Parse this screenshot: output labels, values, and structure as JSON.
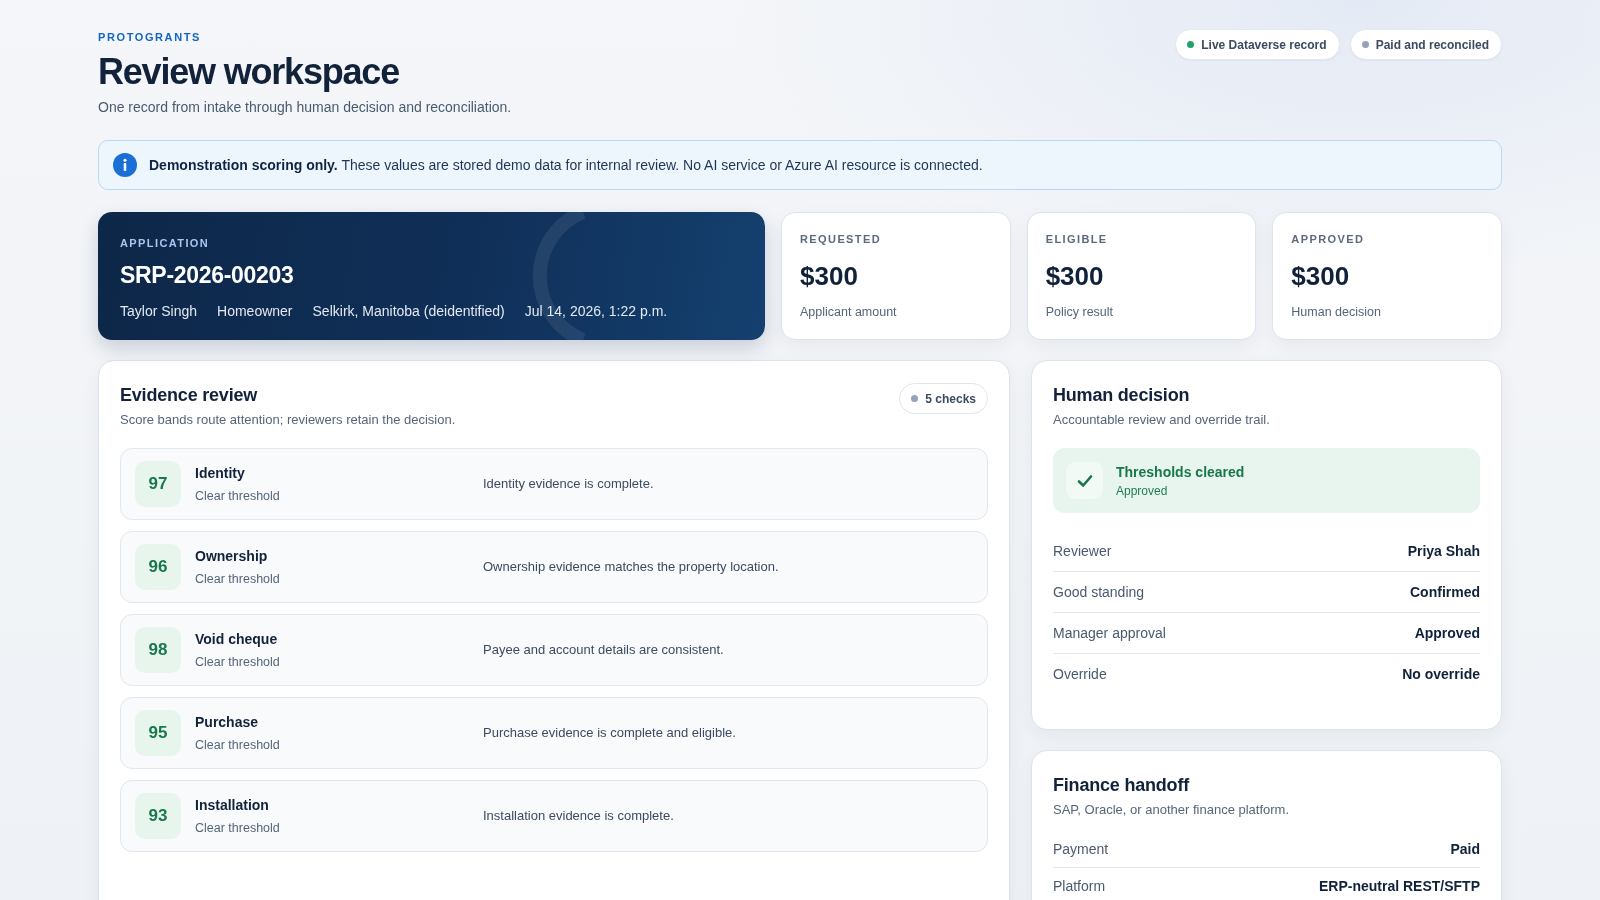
{
  "header": {
    "eyebrow": "PROTOGRANTS",
    "title": "Review workspace",
    "subtitle": "One record from intake through human decision and reconciliation."
  },
  "status_pills": [
    {
      "label": "Live Dataverse record",
      "color": "#22a06b"
    },
    {
      "label": "Paid and reconciled",
      "color": "#94a3b8"
    }
  ],
  "notice": {
    "text": "**Demonstration scoring only.** These values are stored demo data for internal review. No AI service or Azure AI resource is connected."
  },
  "application": {
    "label": "APPLICATION",
    "id": "SRP-2026-00203",
    "meta": [
      "Taylor Singh",
      "Homeowner",
      "Selkirk, Manitoba (deidentified)",
      "Jul 14, 2026, 1:22 p.m."
    ]
  },
  "amounts": [
    {
      "label": "REQUESTED",
      "value": "$300",
      "note": "Applicant amount"
    },
    {
      "label": "ELIGIBLE",
      "value": "$300",
      "note": "Policy result"
    },
    {
      "label": "APPROVED",
      "value": "$300",
      "note": "Human decision"
    }
  ],
  "evidence_review": {
    "title": "Evidence review",
    "subtitle": "Score bands route attention; reviewers retain the decision.",
    "count": "5 checks",
    "checks": [
      {
        "score": "97",
        "name": "Identity",
        "band": "Clear threshold",
        "finding": "Identity evidence is complete."
      },
      {
        "score": "96",
        "name": "Ownership",
        "band": "Clear threshold",
        "finding": "Ownership evidence matches the property location."
      },
      {
        "score": "98",
        "name": "Void cheque",
        "band": "Clear threshold",
        "finding": "Payee and account details are consistent."
      },
      {
        "score": "95",
        "name": "Purchase",
        "band": "Clear threshold",
        "finding": "Purchase evidence is complete and eligible."
      },
      {
        "score": "93",
        "name": "Installation",
        "band": "Clear threshold",
        "finding": "Installation evidence is complete."
      }
    ]
  },
  "human_decision": {
    "title": "Human decision",
    "subtitle": "Accountable review and override trail.",
    "outcome": {
      "title": "Thresholds cleared",
      "status": "Approved"
    },
    "rows": [
      {
        "label": "Reviewer",
        "value": "Priya Shah"
      },
      {
        "label": "Good standing",
        "value": "Confirmed"
      },
      {
        "label": "Manager approval",
        "value": "Approved"
      },
      {
        "label": "Override",
        "value": "No override"
      }
    ]
  },
  "finance_handoff": {
    "title": "Finance handoff",
    "subtitle": "SAP, Oracle, or another finance platform.",
    "rows": [
      {
        "label": "Payment",
        "value": "Paid"
      },
      {
        "label": "Platform",
        "value": "ERP-neutral REST/SFTP"
      }
    ]
  }
}
